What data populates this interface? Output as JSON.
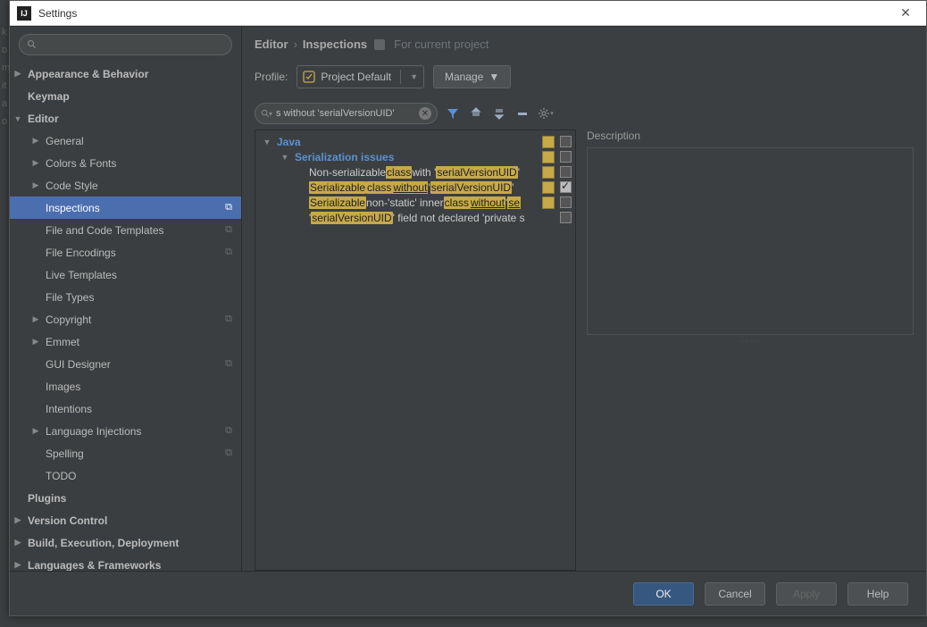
{
  "window": {
    "title": "Settings"
  },
  "sidebar": {
    "search_placeholder": "",
    "items": [
      {
        "label": "Appearance & Behavior",
        "lvl": 1,
        "bold": true,
        "arrow": "right"
      },
      {
        "label": "Keymap",
        "lvl": 1,
        "bold": true,
        "arrow": ""
      },
      {
        "label": "Editor",
        "lvl": 1,
        "bold": true,
        "arrow": "down"
      },
      {
        "label": "General",
        "lvl": 2,
        "arrow": "right"
      },
      {
        "label": "Colors & Fonts",
        "lvl": 2,
        "arrow": "right"
      },
      {
        "label": "Code Style",
        "lvl": 2,
        "arrow": "right"
      },
      {
        "label": "Inspections",
        "lvl": 2,
        "arrow": "",
        "selected": true,
        "icon": "copy"
      },
      {
        "label": "File and Code Templates",
        "lvl": 2,
        "arrow": "",
        "icon": "copy"
      },
      {
        "label": "File Encodings",
        "lvl": 2,
        "arrow": "",
        "icon": "copy"
      },
      {
        "label": "Live Templates",
        "lvl": 2,
        "arrow": ""
      },
      {
        "label": "File Types",
        "lvl": 2,
        "arrow": ""
      },
      {
        "label": "Copyright",
        "lvl": 2,
        "arrow": "right",
        "icon": "copy"
      },
      {
        "label": "Emmet",
        "lvl": 2,
        "arrow": "right"
      },
      {
        "label": "GUI Designer",
        "lvl": 2,
        "arrow": "",
        "icon": "copy"
      },
      {
        "label": "Images",
        "lvl": 2,
        "arrow": ""
      },
      {
        "label": "Intentions",
        "lvl": 2,
        "arrow": ""
      },
      {
        "label": "Language Injections",
        "lvl": 2,
        "arrow": "right",
        "icon": "copy"
      },
      {
        "label": "Spelling",
        "lvl": 2,
        "arrow": "",
        "icon": "copy"
      },
      {
        "label": "TODO",
        "lvl": 2,
        "arrow": ""
      },
      {
        "label": "Plugins",
        "lvl": 1,
        "bold": true,
        "arrow": ""
      },
      {
        "label": "Version Control",
        "lvl": 1,
        "bold": true,
        "arrow": "right"
      },
      {
        "label": "Build, Execution, Deployment",
        "lvl": 1,
        "bold": true,
        "arrow": "right"
      },
      {
        "label": "Languages & Frameworks",
        "lvl": 1,
        "bold": true,
        "arrow": "right"
      }
    ]
  },
  "breadcrumb": {
    "seg1": "Editor",
    "seg2": "Inspections",
    "forproj": "For current project"
  },
  "profile": {
    "label": "Profile:",
    "value": "Project Default",
    "manage": "Manage"
  },
  "insp": {
    "search_value": "s without 'serialVersionUID'",
    "cat": "Java",
    "sub": "Serialization issues",
    "rows": [
      {
        "parts": [
          "Non-serializable ",
          "<class>",
          " with '",
          "<serialVersionUID>",
          "'"
        ],
        "sev": true,
        "checked": false
      },
      {
        "parts": [
          "<Serializable>",
          " ",
          "<class>",
          " ",
          "<without>",
          " '",
          "<serialVersionUID>",
          "'"
        ],
        "sev": true,
        "checked": true
      },
      {
        "parts": [
          "<Serializable>",
          " non-'static' inner ",
          "<class>",
          " ",
          "<without>",
          " '",
          "<se>"
        ],
        "sev": true,
        "checked": false
      },
      {
        "parts": [
          "'",
          "<serialVersionUID>",
          "' field not declared 'private s"
        ],
        "sev": false,
        "checked": false
      }
    ]
  },
  "description_label": "Description",
  "buttons": {
    "ok": "OK",
    "cancel": "Cancel",
    "apply": "Apply",
    "help": "Help"
  }
}
